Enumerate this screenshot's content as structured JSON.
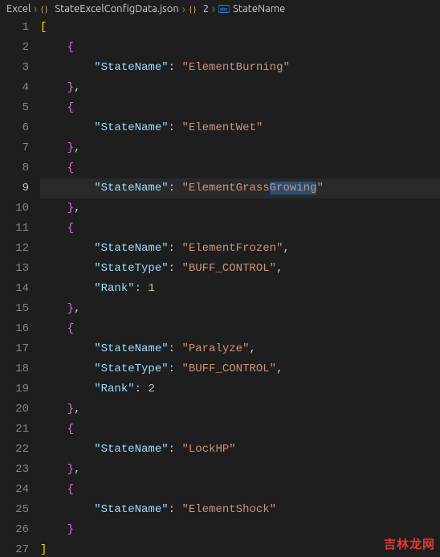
{
  "breadcrumb": {
    "items": [
      {
        "label": "Excel",
        "icon": null
      },
      {
        "label": "StateExcelConfigData.json",
        "icon": "braces"
      },
      {
        "label": "2",
        "icon": "braces"
      },
      {
        "label": "StateName",
        "icon": "abc"
      }
    ],
    "separator": "›"
  },
  "editor": {
    "activeLine": 9,
    "selection": {
      "line": 9,
      "text": "Growing"
    },
    "lines": [
      {
        "n": 1,
        "indent": 0,
        "tokens": [
          {
            "t": "[",
            "c": "bracket-y"
          }
        ]
      },
      {
        "n": 2,
        "indent": 1,
        "tokens": [
          {
            "t": "{",
            "c": "bracket-p"
          }
        ]
      },
      {
        "n": 3,
        "indent": 2,
        "tokens": [
          {
            "t": "\"StateName\"",
            "c": "key"
          },
          {
            "t": ":",
            "c": "colon"
          },
          {
            "t": " ",
            "c": ""
          },
          {
            "t": "\"ElementBurning\"",
            "c": "str"
          }
        ]
      },
      {
        "n": 4,
        "indent": 1,
        "tokens": [
          {
            "t": "}",
            "c": "bracket-p"
          },
          {
            "t": ",",
            "c": "comma"
          }
        ]
      },
      {
        "n": 5,
        "indent": 1,
        "tokens": [
          {
            "t": "{",
            "c": "bracket-p"
          }
        ]
      },
      {
        "n": 6,
        "indent": 2,
        "tokens": [
          {
            "t": "\"StateName\"",
            "c": "key"
          },
          {
            "t": ":",
            "c": "colon"
          },
          {
            "t": " ",
            "c": ""
          },
          {
            "t": "\"ElementWet\"",
            "c": "str"
          }
        ]
      },
      {
        "n": 7,
        "indent": 1,
        "tokens": [
          {
            "t": "}",
            "c": "bracket-p"
          },
          {
            "t": ",",
            "c": "comma"
          }
        ]
      },
      {
        "n": 8,
        "indent": 1,
        "tokens": [
          {
            "t": "{",
            "c": "bracket-p"
          }
        ]
      },
      {
        "n": 9,
        "indent": 2,
        "tokens": [
          {
            "t": "\"StateName\"",
            "c": "key"
          },
          {
            "t": ":",
            "c": "colon"
          },
          {
            "t": " ",
            "c": ""
          },
          {
            "t": "\"ElementGrass",
            "c": "str"
          },
          {
            "t": "Growing",
            "c": "str",
            "sel": true
          },
          {
            "t": "\"",
            "c": "str"
          }
        ]
      },
      {
        "n": 10,
        "indent": 1,
        "tokens": [
          {
            "t": "}",
            "c": "bracket-p"
          },
          {
            "t": ",",
            "c": "comma"
          }
        ]
      },
      {
        "n": 11,
        "indent": 1,
        "tokens": [
          {
            "t": "{",
            "c": "bracket-p"
          }
        ]
      },
      {
        "n": 12,
        "indent": 2,
        "tokens": [
          {
            "t": "\"StateName\"",
            "c": "key"
          },
          {
            "t": ":",
            "c": "colon"
          },
          {
            "t": " ",
            "c": ""
          },
          {
            "t": "\"ElementFrozen\"",
            "c": "str"
          },
          {
            "t": ",",
            "c": "comma"
          }
        ]
      },
      {
        "n": 13,
        "indent": 2,
        "tokens": [
          {
            "t": "\"StateType\"",
            "c": "key"
          },
          {
            "t": ":",
            "c": "colon"
          },
          {
            "t": " ",
            "c": ""
          },
          {
            "t": "\"BUFF_CONTROL\"",
            "c": "str"
          },
          {
            "t": ",",
            "c": "comma"
          }
        ]
      },
      {
        "n": 14,
        "indent": 2,
        "tokens": [
          {
            "t": "\"Rank\"",
            "c": "key"
          },
          {
            "t": ":",
            "c": "colon"
          },
          {
            "t": " ",
            "c": ""
          },
          {
            "t": "1",
            "c": "num"
          }
        ]
      },
      {
        "n": 15,
        "indent": 1,
        "tokens": [
          {
            "t": "}",
            "c": "bracket-p"
          },
          {
            "t": ",",
            "c": "comma"
          }
        ]
      },
      {
        "n": 16,
        "indent": 1,
        "tokens": [
          {
            "t": "{",
            "c": "bracket-p"
          }
        ]
      },
      {
        "n": 17,
        "indent": 2,
        "tokens": [
          {
            "t": "\"StateName\"",
            "c": "key"
          },
          {
            "t": ":",
            "c": "colon"
          },
          {
            "t": " ",
            "c": ""
          },
          {
            "t": "\"Paralyze\"",
            "c": "str"
          },
          {
            "t": ",",
            "c": "comma"
          }
        ]
      },
      {
        "n": 18,
        "indent": 2,
        "tokens": [
          {
            "t": "\"StateType\"",
            "c": "key"
          },
          {
            "t": ":",
            "c": "colon"
          },
          {
            "t": " ",
            "c": ""
          },
          {
            "t": "\"BUFF_CONTROL\"",
            "c": "str"
          },
          {
            "t": ",",
            "c": "comma"
          }
        ]
      },
      {
        "n": 19,
        "indent": 2,
        "tokens": [
          {
            "t": "\"Rank\"",
            "c": "key"
          },
          {
            "t": ":",
            "c": "colon"
          },
          {
            "t": " ",
            "c": ""
          },
          {
            "t": "2",
            "c": "num"
          }
        ]
      },
      {
        "n": 20,
        "indent": 1,
        "tokens": [
          {
            "t": "}",
            "c": "bracket-p"
          },
          {
            "t": ",",
            "c": "comma"
          }
        ]
      },
      {
        "n": 21,
        "indent": 1,
        "tokens": [
          {
            "t": "{",
            "c": "bracket-p"
          }
        ]
      },
      {
        "n": 22,
        "indent": 2,
        "tokens": [
          {
            "t": "\"StateName\"",
            "c": "key"
          },
          {
            "t": ":",
            "c": "colon"
          },
          {
            "t": " ",
            "c": ""
          },
          {
            "t": "\"LockHP\"",
            "c": "str"
          }
        ]
      },
      {
        "n": 23,
        "indent": 1,
        "tokens": [
          {
            "t": "}",
            "c": "bracket-p"
          },
          {
            "t": ",",
            "c": "comma"
          }
        ]
      },
      {
        "n": 24,
        "indent": 1,
        "tokens": [
          {
            "t": "{",
            "c": "bracket-p"
          }
        ]
      },
      {
        "n": 25,
        "indent": 2,
        "tokens": [
          {
            "t": "\"StateName\"",
            "c": "key"
          },
          {
            "t": ":",
            "c": "colon"
          },
          {
            "t": " ",
            "c": ""
          },
          {
            "t": "\"ElementShock\"",
            "c": "str"
          }
        ]
      },
      {
        "n": 26,
        "indent": 1,
        "tokens": [
          {
            "t": "}",
            "c": "bracket-p"
          }
        ]
      },
      {
        "n": 27,
        "indent": 0,
        "tokens": [
          {
            "t": "]",
            "c": "bracket-y"
          }
        ]
      }
    ]
  },
  "watermark": "吉林龙网"
}
